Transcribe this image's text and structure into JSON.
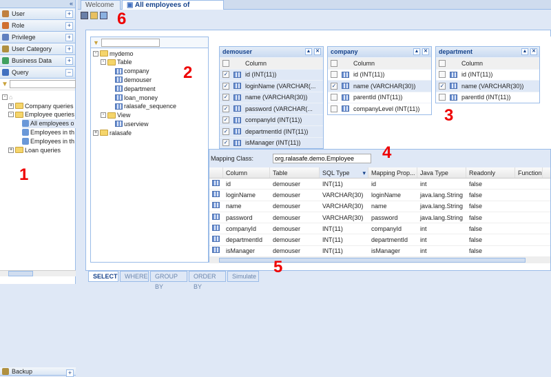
{
  "sidebar": {
    "collapse": "«",
    "sections": [
      {
        "label": "User",
        "color": "#c08040"
      },
      {
        "label": "Role",
        "color": "#d07030"
      },
      {
        "label": "Privilege",
        "color": "#6080c0"
      },
      {
        "label": "User Category",
        "color": "#b09040"
      },
      {
        "label": "Business Data",
        "color": "#40a060"
      },
      {
        "label": "Query",
        "color": "#4070c0",
        "expanded": true
      }
    ],
    "tree": [
      {
        "label": "Company queries",
        "type": "folder",
        "exp": "+"
      },
      {
        "label": "Employee queries",
        "type": "folder",
        "exp": "-"
      },
      {
        "label": "All employees o",
        "type": "query",
        "selected": true
      },
      {
        "label": "Employees in th",
        "type": "query"
      },
      {
        "label": "Employees in th",
        "type": "query"
      },
      {
        "label": "Loan queries",
        "type": "folder",
        "exp": "+"
      }
    ],
    "backup": "Backup"
  },
  "tabs": [
    {
      "label": "Welcome"
    },
    {
      "label": "All employees of corporation",
      "close": "×"
    }
  ],
  "dbtree": {
    "root": "mydemo",
    "table_folder": "Table",
    "tables": [
      "company",
      "demouser",
      "department",
      "loan_money",
      "ralasafe_sequence"
    ],
    "view_folder": "View",
    "views": [
      "userview"
    ],
    "other": "ralasafe"
  },
  "windows": [
    {
      "title": "demouser",
      "header": "Column",
      "rows": [
        {
          "t": "id (INT(11))",
          "c": true
        },
        {
          "t": "loginName (VARCHAR(...",
          "c": true
        },
        {
          "t": "name (VARCHAR(30))",
          "c": true
        },
        {
          "t": "password (VARCHAR(...",
          "c": true
        },
        {
          "t": "companyId (INT(11))",
          "c": true
        },
        {
          "t": "departmentId (INT(11))",
          "c": true
        },
        {
          "t": "isManager (INT(11))",
          "c": true
        }
      ]
    },
    {
      "title": "company",
      "header": "Column",
      "rows": [
        {
          "t": "id (INT(11))",
          "c": false
        },
        {
          "t": "name (VARCHAR(30))",
          "c": true
        },
        {
          "t": "parentId (INT(11))",
          "c": false
        },
        {
          "t": "companyLevel (INT(11))",
          "c": false
        }
      ]
    },
    {
      "title": "department",
      "header": "Column",
      "rows": [
        {
          "t": "id (INT(11))",
          "c": false
        },
        {
          "t": "name (VARCHAR(30))",
          "c": true
        },
        {
          "t": "parentId (INT(11))",
          "c": false
        }
      ]
    }
  ],
  "mapping": {
    "label": "Mapping Class:",
    "value": "org.ralasafe.demo.Employee"
  },
  "grid": {
    "columns": [
      "Column",
      "Table",
      "SQL Type",
      "Mapping Prop...",
      "Java Type",
      "Readonly",
      "Function"
    ],
    "rows": [
      [
        "id",
        "demouser",
        "INT(11)",
        "id",
        "int",
        "false"
      ],
      [
        "loginName",
        "demouser",
        "VARCHAR(30)",
        "loginName",
        "java.lang.String",
        "false"
      ],
      [
        "name",
        "demouser",
        "VARCHAR(30)",
        "name",
        "java.lang.String",
        "false"
      ],
      [
        "password",
        "demouser",
        "VARCHAR(30)",
        "password",
        "java.lang.String",
        "false"
      ],
      [
        "companyId",
        "demouser",
        "INT(11)",
        "companyId",
        "int",
        "false"
      ],
      [
        "departmentId",
        "demouser",
        "INT(11)",
        "departmentId",
        "int",
        "false"
      ],
      [
        "isManager",
        "demouser",
        "INT(11)",
        "isManager",
        "int",
        "false"
      ]
    ]
  },
  "bottom_tabs": [
    "SELECT",
    "WHERE",
    "GROUP BY",
    "ORDER BY",
    "Simulate"
  ],
  "annotations": [
    "1",
    "2",
    "3",
    "4",
    "5",
    "6"
  ]
}
